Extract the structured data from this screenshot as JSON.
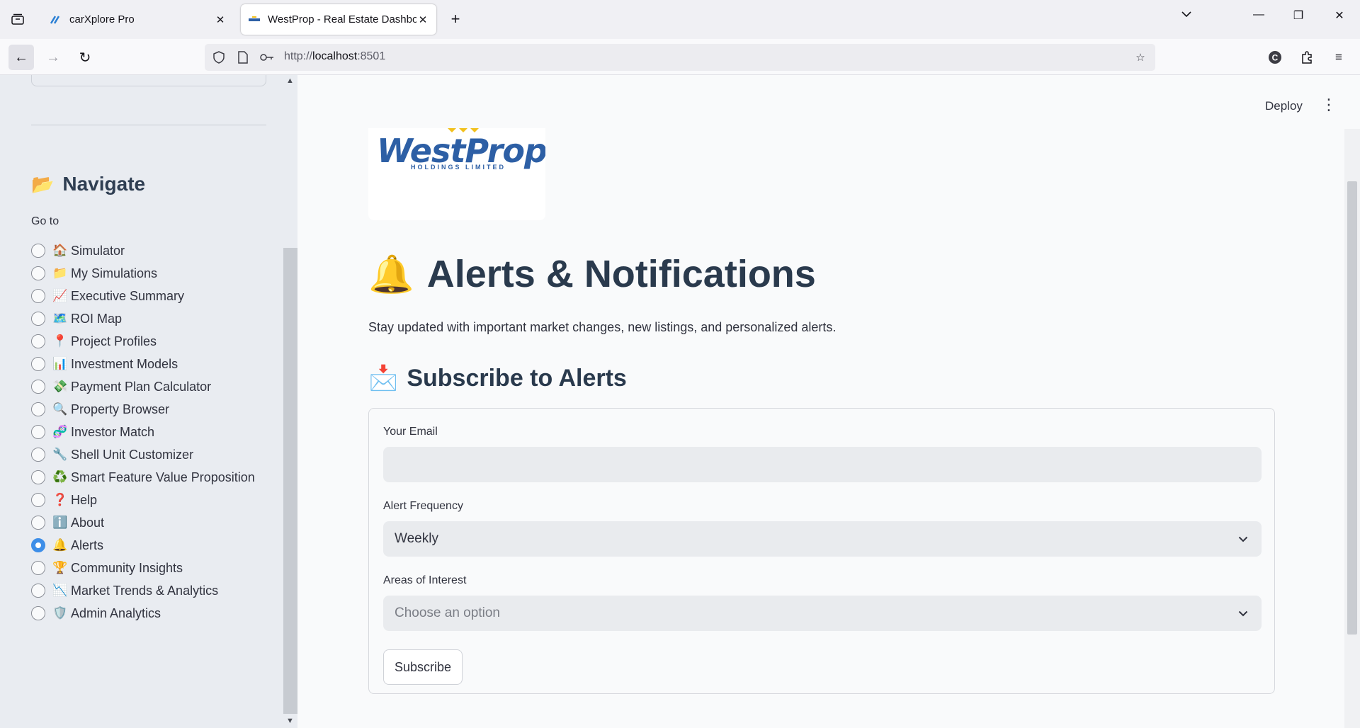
{
  "browser": {
    "tabs": [
      {
        "title": "carXplore Pro",
        "active": false
      },
      {
        "title": "WestProp - Real Estate Dashboard",
        "active": true
      }
    ],
    "url": {
      "scheme": "http://",
      "host": "localhost",
      "port": ":8501"
    }
  },
  "sidebar": {
    "heading": {
      "emoji": "📂",
      "text": "Navigate"
    },
    "goto_label": "Go to",
    "items": [
      {
        "emoji": "🏠",
        "label": "Simulator",
        "checked": false
      },
      {
        "emoji": "📁",
        "label": "My Simulations",
        "checked": false
      },
      {
        "emoji": "📈",
        "label": "Executive Summary",
        "checked": false
      },
      {
        "emoji": "🗺️",
        "label": "ROI Map",
        "checked": false
      },
      {
        "emoji": "📍",
        "label": "Project Profiles",
        "checked": false
      },
      {
        "emoji": "📊",
        "label": "Investment Models",
        "checked": false
      },
      {
        "emoji": "💸",
        "label": "Payment Plan Calculator",
        "checked": false
      },
      {
        "emoji": "🔍",
        "label": "Property Browser",
        "checked": false
      },
      {
        "emoji": "🧬",
        "label": "Investor Match",
        "checked": false
      },
      {
        "emoji": "🔧",
        "label": "Shell Unit Customizer",
        "checked": false
      },
      {
        "emoji": "♻️",
        "label": "Smart Feature Value Proposition",
        "checked": false
      },
      {
        "emoji": "❓",
        "label": "Help",
        "checked": false
      },
      {
        "emoji": "ℹ️",
        "label": "About",
        "checked": false
      },
      {
        "emoji": "🔔",
        "label": "Alerts",
        "checked": true
      },
      {
        "emoji": "🏆",
        "label": "Community Insights",
        "checked": false
      },
      {
        "emoji": "📉",
        "label": "Market Trends & Analytics",
        "checked": false
      },
      {
        "emoji": "🛡️",
        "label": "Admin Analytics",
        "checked": false
      }
    ]
  },
  "header": {
    "deploy_label": "Deploy"
  },
  "logo": {
    "text": "WestProp",
    "subtext": "HOLDINGS LIMITED",
    "color": "#2d5fa5",
    "accent": "#f2c01c"
  },
  "page": {
    "title_emoji": "🔔",
    "title": "Alerts & Notifications",
    "subtitle": "Stay updated with important market changes, new listings, and personalized alerts.",
    "section_emoji": "📩",
    "section_title": "Subscribe to Alerts"
  },
  "form": {
    "email_label": "Your Email",
    "email_value": "",
    "frequency_label": "Alert Frequency",
    "frequency_value": "Weekly",
    "areas_label": "Areas of Interest",
    "areas_placeholder": "Choose an option",
    "submit_label": "Subscribe"
  },
  "colors": {
    "radio_checked": "#3d8ee8",
    "sidebar_bg": "#e9ecf1",
    "heading": "#2a3a4d"
  }
}
